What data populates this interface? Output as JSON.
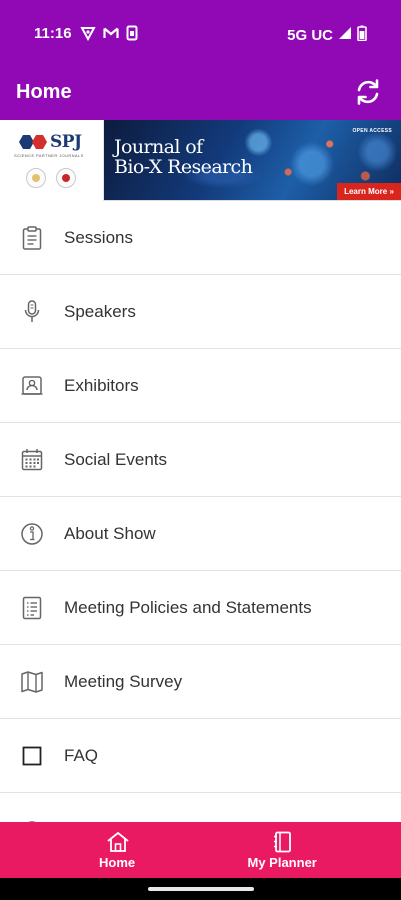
{
  "status_bar": {
    "time": "11:16",
    "network": "5G UC",
    "left_icons": [
      "vpn-icon",
      "gmail-icon",
      "sim-icon"
    ],
    "right_icons": [
      "signal-icon",
      "battery-icon"
    ]
  },
  "app_bar": {
    "title": "Home",
    "action_icon": "refresh-icon"
  },
  "banner": {
    "logo_text": "SPJ",
    "logo_subtitle": "SCIENCE PARTNER JOURNALS",
    "journal_title_line1": "Journal of",
    "journal_title_line2": "Bio-X Research",
    "open_access": "OPEN ACCESS",
    "cta": "Learn More »"
  },
  "menu": {
    "items": [
      {
        "label": "Sessions",
        "icon": "clipboard-icon"
      },
      {
        "label": "Speakers",
        "icon": "microphone-icon"
      },
      {
        "label": "Exhibitors",
        "icon": "exhibitor-icon"
      },
      {
        "label": "Social Events",
        "icon": "calendar-icon"
      },
      {
        "label": "About Show",
        "icon": "info-icon"
      },
      {
        "label": "Meeting Policies and Statements",
        "icon": "document-list-icon"
      },
      {
        "label": "Meeting Survey",
        "icon": "map-icon"
      },
      {
        "label": "FAQ",
        "icon": "square-icon"
      }
    ]
  },
  "bottom_nav": {
    "tabs": [
      {
        "label": "Home",
        "icon": "home-icon"
      },
      {
        "label": "My Planner",
        "icon": "planner-icon"
      }
    ]
  },
  "colors": {
    "app_bar": "#9109b4",
    "bottom_nav": "#ea1a62",
    "cta": "#d8261e",
    "text": "#333333"
  }
}
